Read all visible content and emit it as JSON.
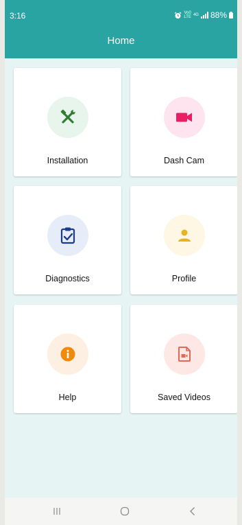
{
  "status_bar": {
    "time": "3:16",
    "network_top": "Vo0",
    "network_bottom": "LTE",
    "network_type": "4G",
    "battery": "88%"
  },
  "app_bar": {
    "title": "Home"
  },
  "cards": [
    {
      "label": "Installation",
      "icon": "tools-icon",
      "circle_color": "#e8f5ec",
      "icon_color": "#2e7d32"
    },
    {
      "label": "Dash Cam",
      "icon": "video-camera-icon",
      "circle_color": "#fde4ef",
      "icon_color": "#e91e63"
    },
    {
      "label": "Diagnostics",
      "icon": "clipboard-check-icon",
      "circle_color": "#e6edf8",
      "icon_color": "#1b3c8c"
    },
    {
      "label": "Profile",
      "icon": "person-icon",
      "circle_color": "#fdf7e4",
      "icon_color": "#e6b323"
    },
    {
      "label": "Help",
      "icon": "info-icon",
      "circle_color": "#fdf0e2",
      "icon_color": "#ef8a0c"
    },
    {
      "label": "Saved Videos",
      "icon": "video-file-icon",
      "circle_color": "#fde8e6",
      "icon_color": "#e06a5a"
    }
  ],
  "colors": {
    "accent": "#2aa3a3",
    "background": "#e6f5f4"
  }
}
